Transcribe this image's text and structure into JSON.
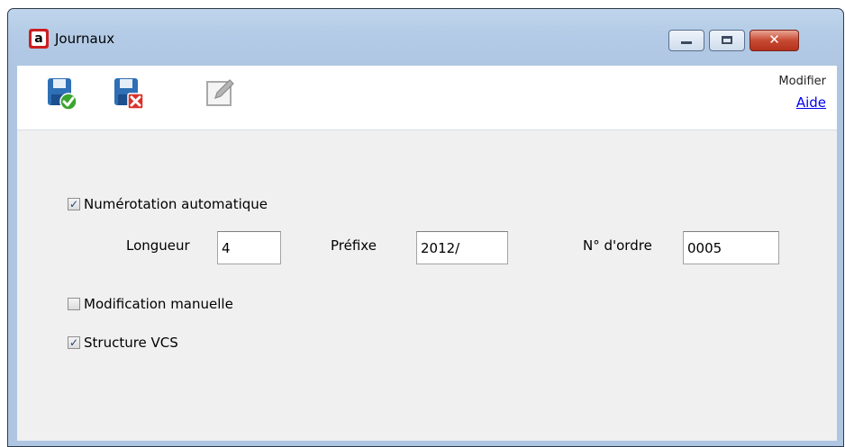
{
  "window": {
    "title": "Journaux",
    "controls": {
      "minimize": "minimize",
      "maximize": "maximize",
      "close": "✕"
    }
  },
  "toolbar": {
    "mode_label": "Modifier",
    "help_link": "Aide",
    "icons": [
      "save-valid-icon",
      "save-cancel-icon",
      "edit-icon"
    ]
  },
  "form": {
    "auto_numbering": {
      "label": "Numérotation automatique",
      "checked": true
    },
    "length": {
      "label": "Longueur",
      "value": "4"
    },
    "prefix": {
      "label": "Préfixe",
      "value": "2012/"
    },
    "order_number": {
      "label": "N° d'ordre",
      "value": "0005"
    },
    "manual_edit": {
      "label": "Modification manuelle",
      "checked": false
    },
    "vcs_structure": {
      "label": "Structure VCS",
      "checked": true
    }
  }
}
